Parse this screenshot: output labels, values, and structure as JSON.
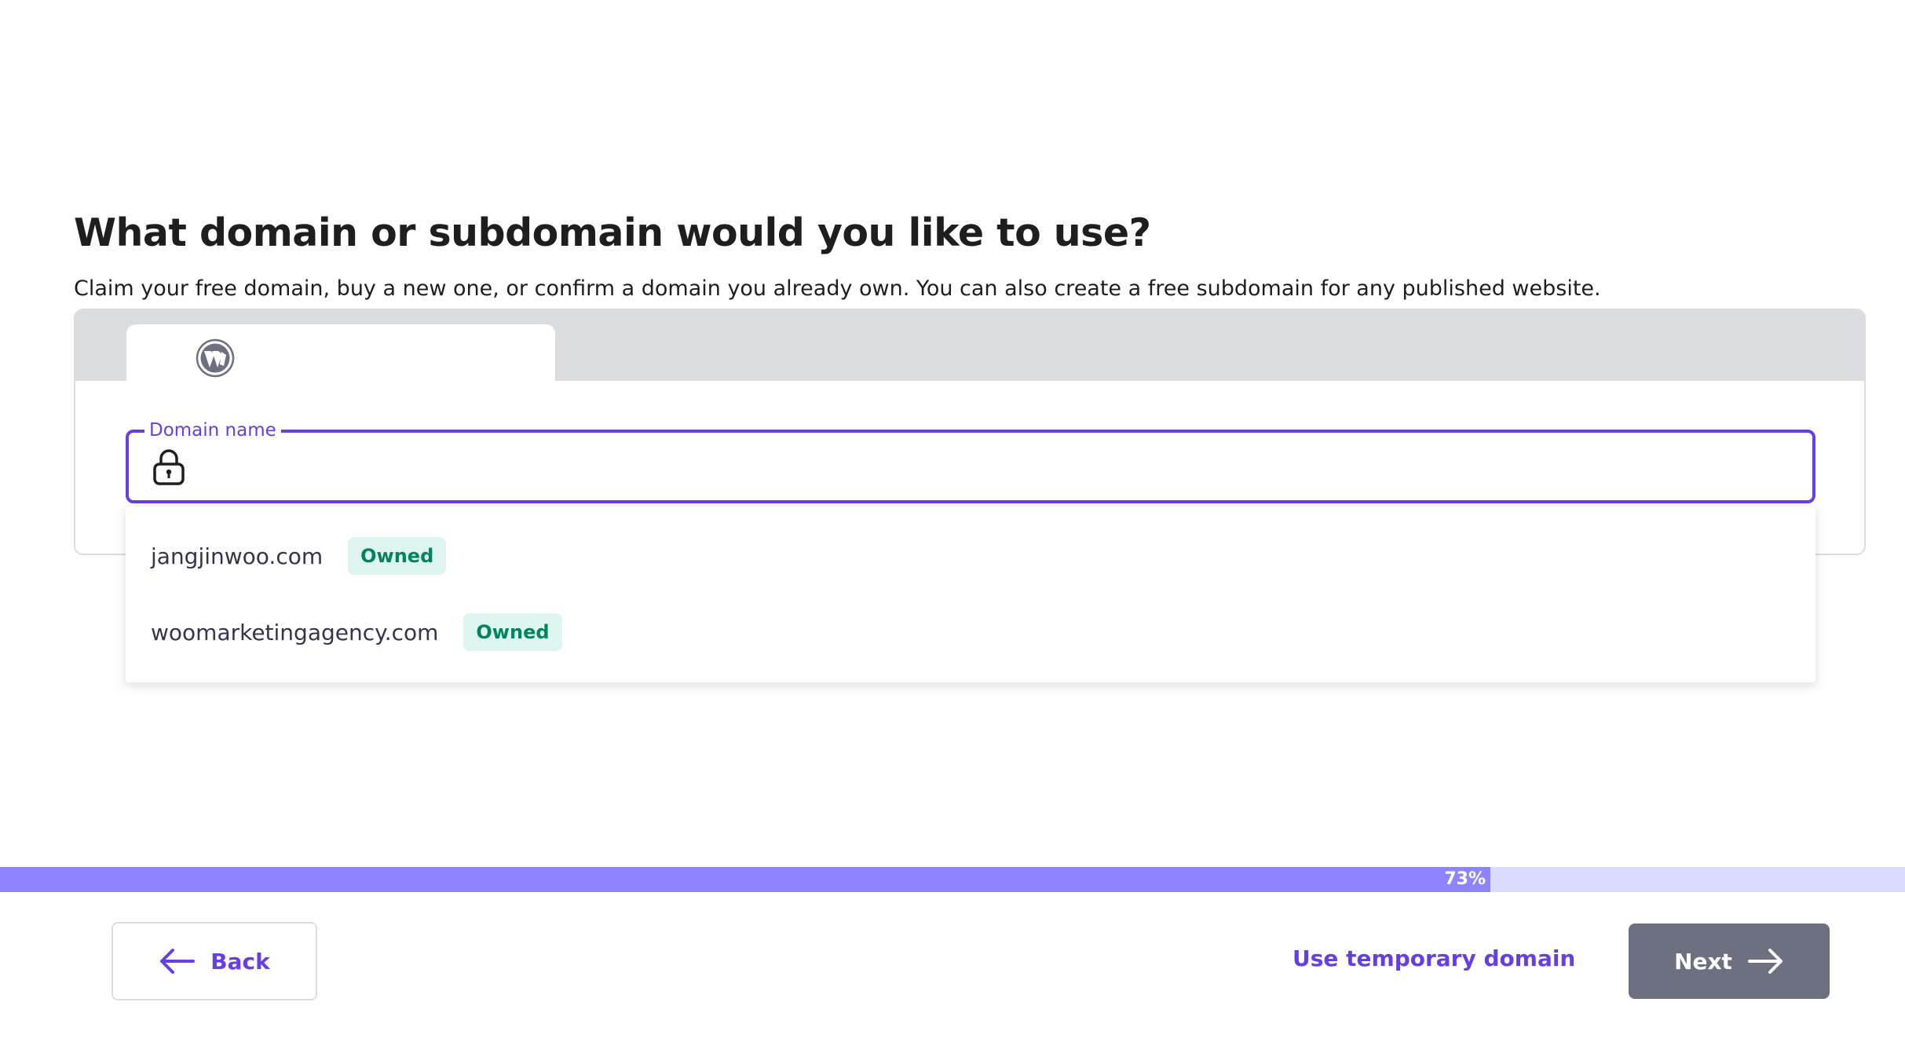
{
  "heading": {
    "title": "What domain or subdomain would you like to use?",
    "subtitle": "Claim your free domain, buy a new one, or confirm a domain you already own. You can also create a free subdomain for any published website."
  },
  "tabs": {
    "active_icon": "wordpress-icon"
  },
  "domain_field": {
    "label": "Domain name",
    "value": "",
    "icon": "lock-icon"
  },
  "suggestions": [
    {
      "domain": "jangjinwoo.com",
      "badge": "Owned"
    },
    {
      "domain": "woomarketingagency.com",
      "badge": "Owned"
    }
  ],
  "progress": {
    "percent": 73,
    "label": "73%"
  },
  "footer": {
    "back_label": "Back",
    "temp_domain_label": "Use temporary domain",
    "next_label": "Next"
  },
  "colors": {
    "accent": "#673de6",
    "progress_fill": "#8c85ff",
    "progress_track": "#d9dcff",
    "next_button": "#6d7081",
    "badge_bg": "#def4f0",
    "badge_text": "#008361"
  }
}
